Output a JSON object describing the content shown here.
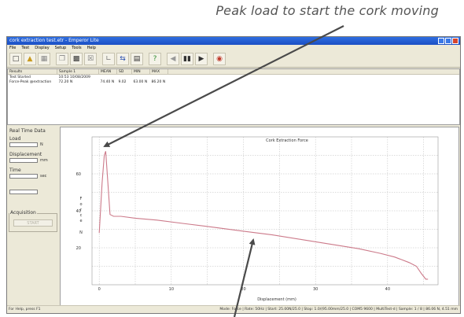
{
  "annotation_top": "Peak load to start the cork moving",
  "window": {
    "title": "cork extraction test.etr - Emperor Lite",
    "menu": [
      "File",
      "Test",
      "Display",
      "Setup",
      "Tools",
      "Help"
    ],
    "toolbar_icons": [
      "new-icon",
      "open-icon",
      "save-icon",
      "copy-icon",
      "print-icon",
      "export-icon",
      "chart-icon",
      "zero-icon",
      "report-icon",
      "help-icon",
      "back-icon",
      "pause-icon",
      "play-icon",
      "stop-icon"
    ]
  },
  "results": {
    "headers": [
      "Results",
      "Sample 1",
      "MEAN",
      "SD",
      "MIN",
      "MAX"
    ],
    "rows": [
      [
        "Test Started",
        "10:53 10/08/2009",
        "",
        "",
        "",
        ""
      ],
      [
        "Force-Peak @extraction",
        "72.20 N",
        "74.40 N",
        "9.02",
        "63.00 N",
        "86.20 N"
      ]
    ]
  },
  "left_panel": {
    "title": "Real Time Data",
    "load_label": "Load",
    "load_unit": "N",
    "displacement_label": "Displacement",
    "displacement_unit": "mm",
    "time_label": "Time",
    "time_unit": "sec",
    "acquisition_label": "Acquisition",
    "start_label": "START"
  },
  "chart_data": {
    "type": "line",
    "title": "Cork Extraction Force",
    "xlabel": "Displacement (mm)",
    "ylabel": "Force N",
    "xlim": [
      -1,
      47
    ],
    "ylim": [
      0,
      80
    ],
    "xticks": [
      0,
      10,
      20,
      30,
      40
    ],
    "yticks": [
      20,
      40,
      60
    ],
    "grid": true,
    "series": [
      {
        "color": "#cc7a8a",
        "x": [
          0,
          0.4,
          0.7,
          0.9,
          1.2,
          1.5,
          2,
          3,
          5,
          8,
          12,
          16,
          20,
          24,
          28,
          32,
          36,
          39,
          41,
          43,
          44,
          44.7,
          45.3,
          45.6
        ],
        "y": [
          28,
          55,
          70,
          72.2,
          55,
          38,
          37,
          37,
          36,
          35,
          33,
          31,
          29,
          27,
          24.5,
          22,
          19.5,
          17,
          15,
          12,
          10,
          6,
          3,
          3
        ]
      }
    ]
  },
  "status": {
    "left": "For Help, press F1",
    "right": "Mode: Force | Rate: 50Hz | Start: 25.00N/25.0 | Stop: 1.0/(95.00mm/25.0 | COM5 9600 | MultiTest-d | Sample: 1 / 8 | 86.06 N, 4.51 mm"
  },
  "arrow_color": "#4a4a4a"
}
